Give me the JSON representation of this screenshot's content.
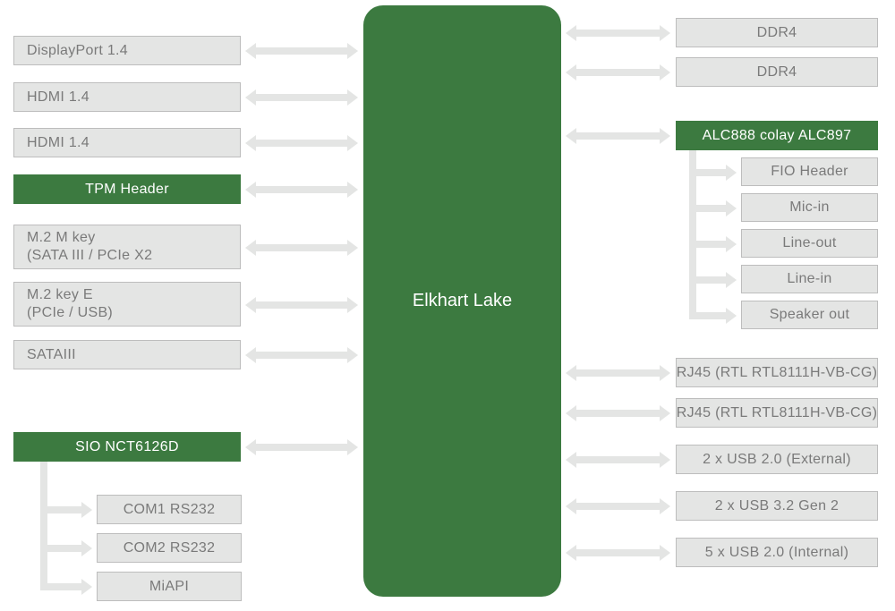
{
  "cpu": "Elkhart Lake",
  "left": {
    "dp": "DisplayPort 1.4",
    "hdmi1": "HDMI 1.4",
    "hdmi2": "HDMI 1.4",
    "tpm": "TPM Header",
    "m2m_l1": "M.2 M key",
    "m2m_l2": "(SATA III / PCIe X2",
    "m2e_l1": "M.2 key E",
    "m2e_l2": "(PCIe / USB)",
    "sata": "SATAIII",
    "sio": "SIO NCT6126D",
    "com1": "COM1 RS232",
    "com2": "COM2 RS232",
    "miapi": "MiAPI"
  },
  "right": {
    "ddr4a": "DDR4",
    "ddr4b": "DDR4",
    "audio": "ALC888 colay ALC897",
    "fio": "FIO Header",
    "micin": "Mic-in",
    "lineout": "Line-out",
    "linein": "Line-in",
    "spk": "Speaker out",
    "rj45a": "RJ45 (RTL RTL8111H-VB-CG)",
    "rj45b": "RJ45 (RTL RTL8111H-VB-CG)",
    "usb20e": "2 x USB 2.0 (External)",
    "usb32": "2 x USB 3.2 Gen 2",
    "usb20i": "5 x USB 2.0 (Internal)"
  }
}
